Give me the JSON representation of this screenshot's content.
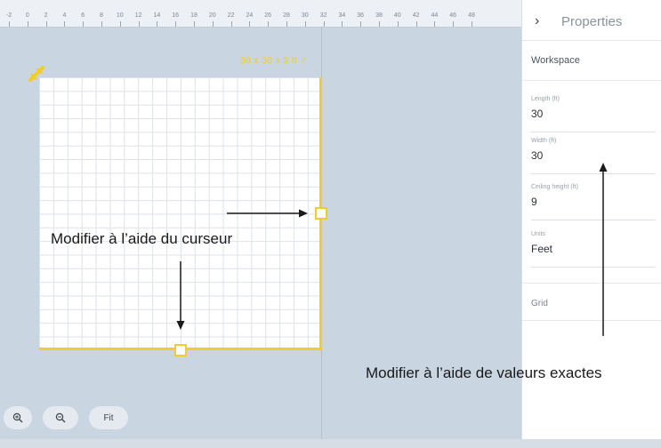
{
  "canvas": {
    "ruler_labels": [
      "-2",
      "0",
      "2",
      "4",
      "6",
      "8",
      "10",
      "12",
      "14",
      "16",
      "18",
      "20",
      "22",
      "24",
      "26",
      "28",
      "30",
      "32",
      "34",
      "36",
      "38",
      "40",
      "42",
      "44",
      "46",
      "48"
    ],
    "dimensions_label": "30 x 30 x 9 ft ✓",
    "accent_color": "#f2cc2a",
    "grid_line_color": "#dde3ea",
    "background_color": "#c9d5e0"
  },
  "annotations": {
    "cursor": "Modifier à l’aide du curseur",
    "exact_values": "Modifier à l’aide de valeurs exactes"
  },
  "zoom": {
    "zoom_in_icon": "zoom-in-icon",
    "zoom_out_icon": "zoom-out-icon",
    "fit_label": "Fit"
  },
  "panel": {
    "chevron": "›",
    "title": "Properties",
    "section_heading": "Workspace",
    "fields": [
      {
        "label": "Length (ft)",
        "value": "30"
      },
      {
        "label": "Width (ft)",
        "value": "30"
      },
      {
        "label": "Ceiling height (ft)",
        "value": "9"
      },
      {
        "label": "Units",
        "value": "Feet"
      }
    ],
    "grid_label": "Grid"
  }
}
